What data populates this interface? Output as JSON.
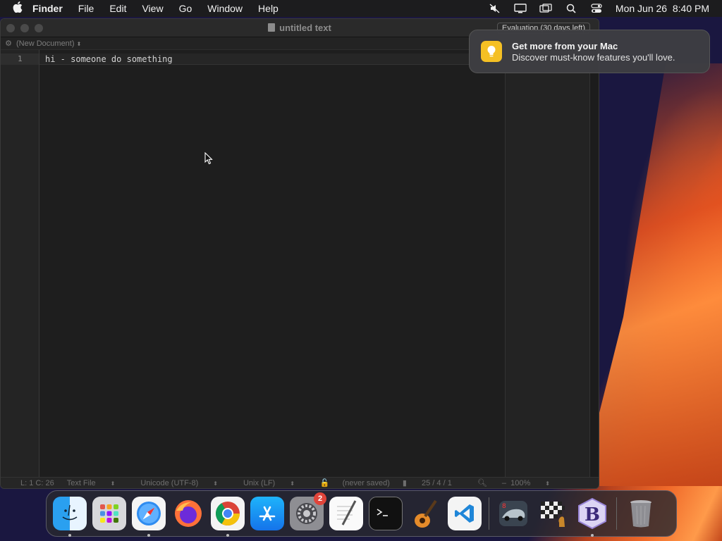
{
  "menubar": {
    "app_name": "Finder",
    "items": [
      "File",
      "Edit",
      "View",
      "Go",
      "Window",
      "Help"
    ],
    "datetime": "Mon Jun 26  8:40 PM",
    "status_icons": [
      "mute-icon",
      "display-icon",
      "screen-mirroring-icon",
      "spotlight-icon",
      "control-center-icon"
    ]
  },
  "window": {
    "title": "untitled text",
    "eval_badge": "Evaluation (30 days left)",
    "nav_document": "(New Document)",
    "line_number": "1",
    "line_text": "hi - someone do something",
    "status": {
      "position": "L: 1 C: 26",
      "syntax": "Text File",
      "encoding": "Unicode (UTF-8)",
      "line_endings": "Unix (LF)",
      "save_state": "(never saved)",
      "stats": "25 / 4 / 1",
      "zoom": "100%"
    }
  },
  "notification": {
    "title": "Get more from your Mac",
    "body": "Discover must-know features you'll love."
  },
  "dock": {
    "system_settings_badge": "2",
    "items": [
      "finder",
      "launchpad",
      "safari",
      "firefox",
      "chrome",
      "app-store",
      "system-settings",
      "textedit",
      "terminal",
      "garageband",
      "vscode",
      "racing-game",
      "chess",
      "bbedit",
      "trash"
    ]
  },
  "colors": {
    "window_bg": "#1e1e1e",
    "notification_icon": "#f5c024",
    "badge": "#e0443a",
    "wallpaper_accent": "#f06a2a"
  }
}
